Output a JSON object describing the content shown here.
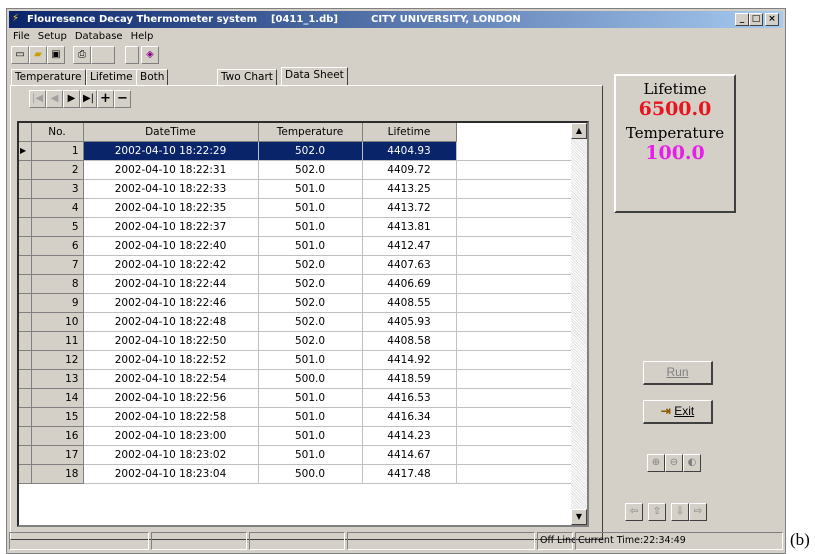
{
  "window": {
    "title": "Flouresence Decay Thermometer system",
    "db": "[0411_1.db]",
    "company": "CITY UNIVERSITY, LONDON",
    "btn_min": "_",
    "btn_max": "□",
    "btn_close": "×"
  },
  "menu": {
    "items": [
      {
        "label": "File"
      },
      {
        "label": "Setup"
      },
      {
        "label": "Database"
      },
      {
        "label": "Help"
      }
    ]
  },
  "tabs": [
    {
      "label": "Temperature"
    },
    {
      "label": "Lifetime"
    },
    {
      "label": "Both"
    },
    {
      "label": "Two Chart"
    },
    {
      "label": "Data Sheet"
    }
  ],
  "grid": {
    "columns": [
      "No.",
      "DateTime",
      "Temperature",
      "Lifetime"
    ],
    "rows": [
      {
        "no": "1",
        "datetime": "2002-04-10 18:22:29",
        "temperature": "502.0",
        "lifetime": "4404.93"
      },
      {
        "no": "2",
        "datetime": "2002-04-10 18:22:31",
        "temperature": "502.0",
        "lifetime": "4409.72"
      },
      {
        "no": "3",
        "datetime": "2002-04-10 18:22:33",
        "temperature": "501.0",
        "lifetime": "4413.25"
      },
      {
        "no": "4",
        "datetime": "2002-04-10 18:22:35",
        "temperature": "501.0",
        "lifetime": "4413.72"
      },
      {
        "no": "5",
        "datetime": "2002-04-10 18:22:37",
        "temperature": "501.0",
        "lifetime": "4413.81"
      },
      {
        "no": "6",
        "datetime": "2002-04-10 18:22:40",
        "temperature": "501.0",
        "lifetime": "4412.47"
      },
      {
        "no": "7",
        "datetime": "2002-04-10 18:22:42",
        "temperature": "502.0",
        "lifetime": "4407.63"
      },
      {
        "no": "8",
        "datetime": "2002-04-10 18:22:44",
        "temperature": "502.0",
        "lifetime": "4406.69"
      },
      {
        "no": "9",
        "datetime": "2002-04-10 18:22:46",
        "temperature": "502.0",
        "lifetime": "4408.55"
      },
      {
        "no": "10",
        "datetime": "2002-04-10 18:22:48",
        "temperature": "502.0",
        "lifetime": "4405.93"
      },
      {
        "no": "11",
        "datetime": "2002-04-10 18:22:50",
        "temperature": "502.0",
        "lifetime": "4408.58"
      },
      {
        "no": "12",
        "datetime": "2002-04-10 18:22:52",
        "temperature": "501.0",
        "lifetime": "4414.92"
      },
      {
        "no": "13",
        "datetime": "2002-04-10 18:22:54",
        "temperature": "500.0",
        "lifetime": "4418.59"
      },
      {
        "no": "14",
        "datetime": "2002-04-10 18:22:56",
        "temperature": "501.0",
        "lifetime": "4416.53"
      },
      {
        "no": "15",
        "datetime": "2002-04-10 18:22:58",
        "temperature": "501.0",
        "lifetime": "4416.34"
      },
      {
        "no": "16",
        "datetime": "2002-04-10 18:23:00",
        "temperature": "501.0",
        "lifetime": "4414.23"
      },
      {
        "no": "17",
        "datetime": "2002-04-10 18:23:02",
        "temperature": "501.0",
        "lifetime": "4414.67"
      },
      {
        "no": "18",
        "datetime": "2002-04-10 18:23:04",
        "temperature": "500.0",
        "lifetime": "4417.48"
      }
    ]
  },
  "readout": {
    "lifetime_label": "Lifetime",
    "lifetime_value": "6500.0",
    "temperature_label": "Temperature",
    "temperature_value": "100.0",
    "lifetime_color": "#e8141e",
    "temperature_color": "#e81ee8"
  },
  "buttons": {
    "run": "Run",
    "exit": "Exit"
  },
  "status": {
    "mode": "Off Line",
    "time": "Current Time:22:34:49"
  },
  "caption": "(b)"
}
